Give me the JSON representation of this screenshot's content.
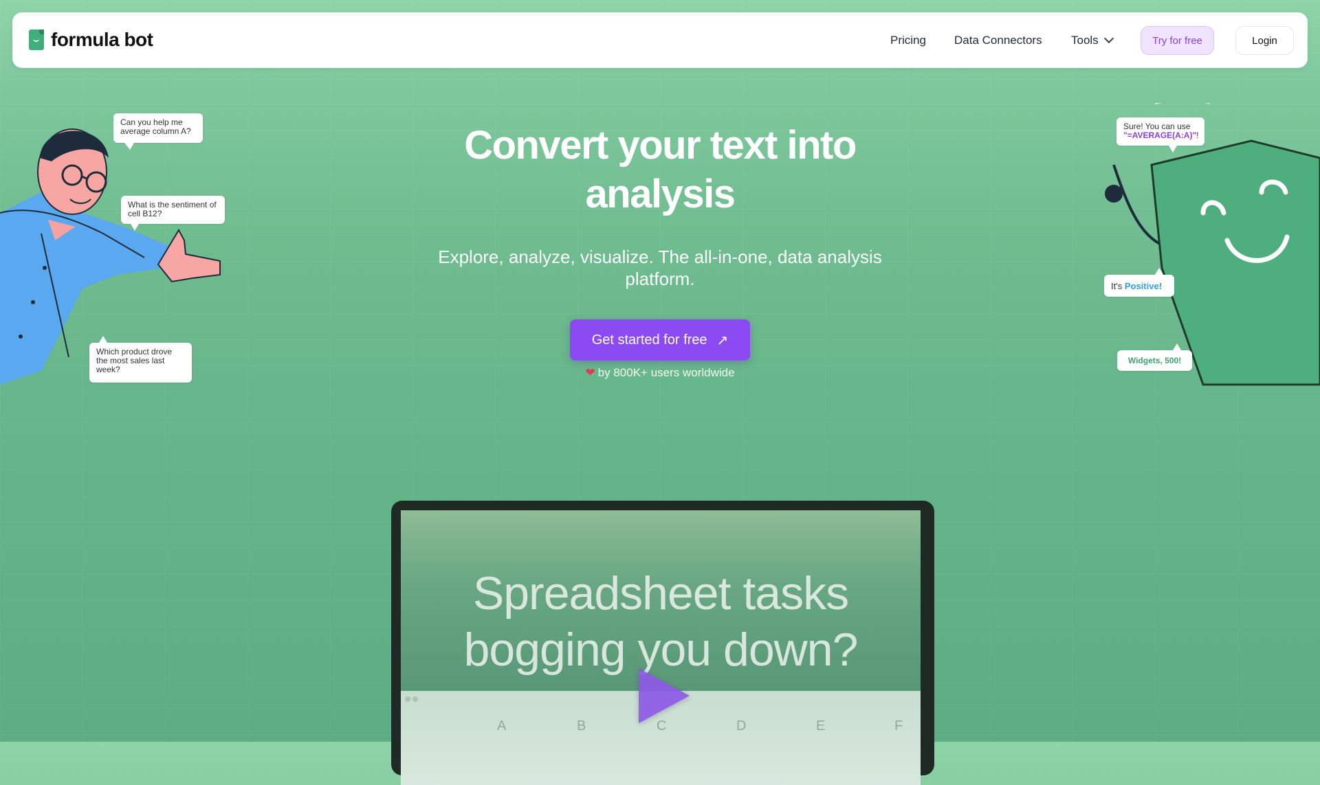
{
  "nav": {
    "brand": "formula bot",
    "pricing": "Pricing",
    "data_connectors": "Data Connectors",
    "tools": "Tools",
    "try_free": "Try for free",
    "login": "Login"
  },
  "hero": {
    "title_line1": "Convert your text into",
    "title_line2": "analysis",
    "subtitle": "Explore, analyze, visualize. The all-in-one, data analysis platform.",
    "cta": "Get started for free",
    "users_text": "by 800K+ users worldwide"
  },
  "bubbles": {
    "q1": "Can you help me average column A?",
    "q2": "What is the sentiment of cell B12?",
    "q3": "Which product drove the most sales last week?",
    "a1_prefix": "Sure! You can use",
    "a1_code": "\"=AVERAGE(A:A)\"",
    "a1_suffix": "!",
    "a2_prefix": "It's",
    "a2_value": "Positive",
    "a2_suffix": "!",
    "a3": "Widgets, 500!"
  },
  "video": {
    "line1": "Spreadsheet tasks",
    "line2": "bogging you down?",
    "columns": [
      "A",
      "B",
      "C",
      "D",
      "E",
      "F"
    ]
  },
  "colors": {
    "accent": "#8c4af2",
    "brand_green": "#3fae7a",
    "try_bg": "#efe3fd"
  }
}
